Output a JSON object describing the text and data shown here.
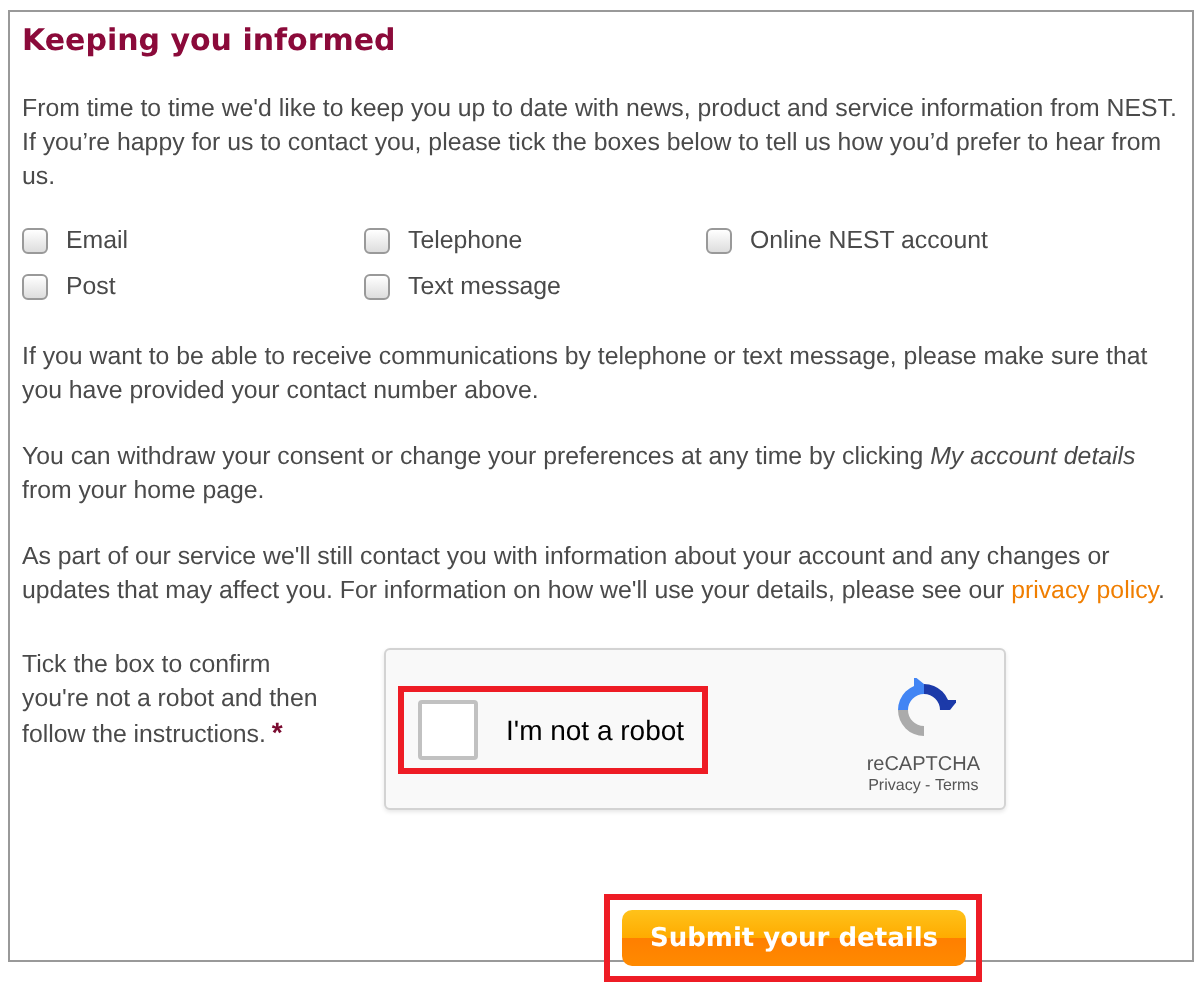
{
  "heading": "Keeping you informed",
  "intro": "From time to time we'd like to keep you up to date with news, product and service information from NEST. If you’re happy for us to contact you, please tick the boxes below to tell us how you’d prefer to hear from us.",
  "options": [
    {
      "label": "Email",
      "checked": false
    },
    {
      "label": "Telephone",
      "checked": false
    },
    {
      "label": "Online NEST account",
      "checked": false
    },
    {
      "label": "Post",
      "checked": false
    },
    {
      "label": "Text message",
      "checked": false
    }
  ],
  "notes": [
    {
      "text": "If you want to be able to receive communications by telephone or text message, please make sure that you have provided your contact number above."
    },
    {
      "text": "You can withdraw your consent or change your preferences at any time by clicking *My account details* from your home page."
    },
    {
      "text": "As part of our service we'll still contact you with information about your account and any changes or updates that may affect you. For information on how we'll use your details, please see our ",
      "link": "privacy policy",
      "after": "."
    }
  ],
  "captcha_prompt": "Tick the box to confirm you're not a robot and then follow the instructions.",
  "required_mark": "*",
  "captcha": {
    "label": "I'm not a robot",
    "checked": false,
    "brand": "reCAPTCHA",
    "privacy": "Privacy",
    "separator": " - ",
    "terms": "Terms",
    "highlighted": true
  },
  "submit": {
    "label": "Submit your details",
    "highlighted": true
  }
}
